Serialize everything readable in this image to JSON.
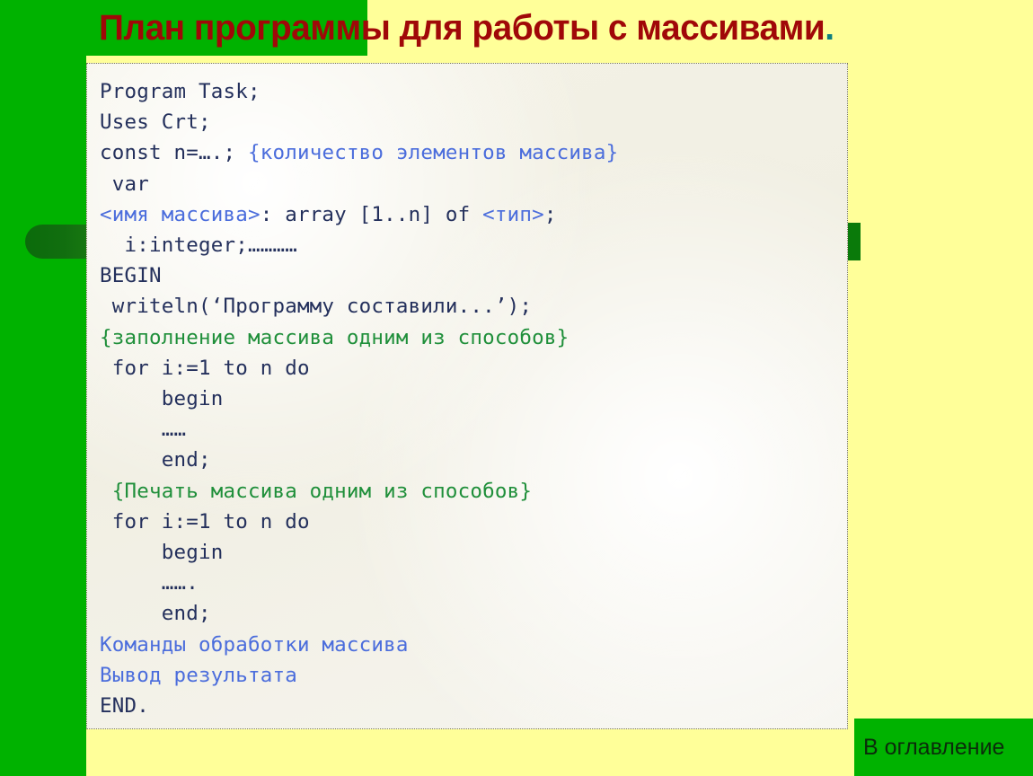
{
  "slide": {
    "title": "План программы для работы с массивами",
    "title_terminator": ".",
    "colors": {
      "green_band": "#00b200",
      "yellow_background": "#ffff99",
      "title_red": "#a00808",
      "title_dot_teal": "#0f7f7f",
      "code_dark_navy": "#24305c",
      "code_blue": "#4b6ddc",
      "code_green": "#1f8f3a",
      "paper": "#f4f2e6",
      "deco_dark_green": "#0a7a0a"
    }
  },
  "code": {
    "lines": [
      {
        "id": "line-program",
        "segments": [
          {
            "text": "Program Task;",
            "color": "dark"
          }
        ]
      },
      {
        "id": "line-uses",
        "segments": [
          {
            "text": "Uses Crt;",
            "color": "dark"
          }
        ]
      },
      {
        "id": "line-const",
        "segments": [
          {
            "text": "const n=….; ",
            "color": "dark"
          },
          {
            "text": "{количество элементов массива}",
            "color": "blue"
          }
        ]
      },
      {
        "id": "line-var",
        "segments": [
          {
            "text": " var",
            "color": "dark"
          }
        ]
      },
      {
        "id": "line-array-decl",
        "segments": [
          {
            "text": "<имя массива>",
            "color": "blue"
          },
          {
            "text": ": array [1..n] of ",
            "color": "dark"
          },
          {
            "text": "<тип>",
            "color": "blue"
          },
          {
            "text": ";",
            "color": "dark"
          }
        ]
      },
      {
        "id": "line-i-integer",
        "segments": [
          {
            "text": "  i:integer;…………",
            "color": "dark"
          }
        ]
      },
      {
        "id": "line-begin-main",
        "segments": [
          {
            "text": "BEGIN",
            "color": "dark"
          }
        ]
      },
      {
        "id": "line-writeln",
        "segments": [
          {
            "text": " writeln(‘Программу составили...’);",
            "color": "dark"
          }
        ]
      },
      {
        "id": "line-comment-fill",
        "segments": [
          {
            "text": "{заполнение массива одним из способов}",
            "color": "green"
          }
        ]
      },
      {
        "id": "line-for-fill",
        "segments": [
          {
            "text": " for i:=1 to n do",
            "color": "dark"
          }
        ]
      },
      {
        "id": "line-begin-fill",
        "segments": [
          {
            "text": "     begin",
            "color": "dark"
          }
        ]
      },
      {
        "id": "line-dots-fill",
        "segments": [
          {
            "text": "     ……",
            "color": "dark"
          }
        ]
      },
      {
        "id": "line-end-fill",
        "segments": [
          {
            "text": "     end;",
            "color": "dark"
          }
        ]
      },
      {
        "id": "line-comment-print",
        "segments": [
          {
            "text": " {Печать массива одним из способов}",
            "color": "green"
          }
        ]
      },
      {
        "id": "line-for-print",
        "segments": [
          {
            "text": " for i:=1 to n do",
            "color": "dark"
          }
        ]
      },
      {
        "id": "line-begin-print",
        "segments": [
          {
            "text": "     begin",
            "color": "dark"
          }
        ]
      },
      {
        "id": "line-dots-print",
        "segments": [
          {
            "text": "     …….",
            "color": "dark"
          }
        ]
      },
      {
        "id": "line-end-print",
        "segments": [
          {
            "text": "     end;",
            "color": "dark"
          }
        ]
      },
      {
        "id": "line-commands",
        "segments": [
          {
            "text": "Команды обработки массива",
            "color": "blue"
          }
        ]
      },
      {
        "id": "line-output",
        "segments": [
          {
            "text": "Вывод результата",
            "color": "blue"
          }
        ]
      },
      {
        "id": "line-end-main",
        "segments": [
          {
            "text": "END.",
            "color": "dark"
          }
        ]
      }
    ]
  },
  "navigation": {
    "toc_label": "В оглавление"
  }
}
